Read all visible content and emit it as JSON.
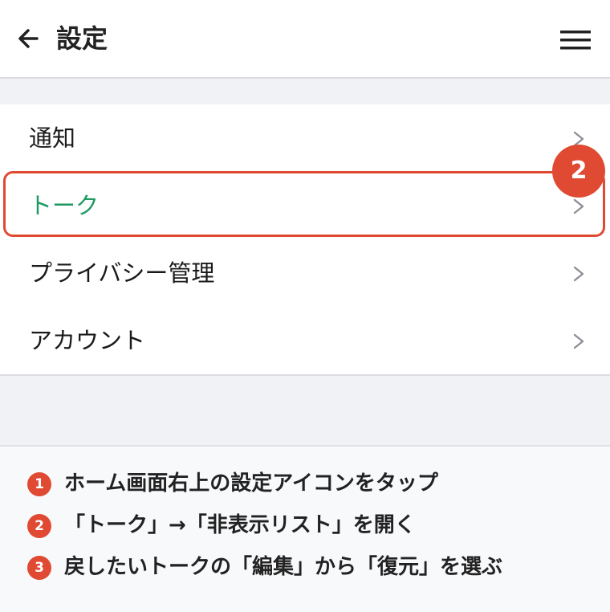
{
  "header": {
    "title": "設定",
    "back_icon": "arrow-left-icon",
    "menu_icon": "hamburger-menu-icon"
  },
  "settings_list": {
    "items": [
      {
        "label": "通知"
      },
      {
        "label": "トーク"
      },
      {
        "label": "プライバシー管理"
      },
      {
        "label": "アカウント"
      }
    ],
    "chevron_icon": "chevron-right-icon"
  },
  "callout": {
    "badge": "2"
  },
  "instructions": {
    "steps": [
      {
        "number": "1",
        "text": "ホーム画面右上の設定アイコンをタップ"
      },
      {
        "number": "2",
        "text": "「トーク」→「非表示リスト」を開く"
      },
      {
        "number": "3",
        "text": "戻したいトークの「編集」から「復元」を選ぶ"
      }
    ]
  },
  "colors": {
    "accent": "#e04a33",
    "active_text": "#1f9a62",
    "background": "#f1f2f5"
  }
}
